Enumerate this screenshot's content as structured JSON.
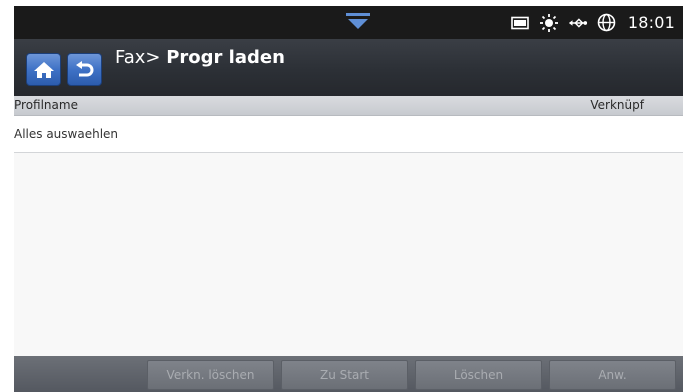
{
  "status_bar": {
    "clock": "18:01",
    "icons": [
      "notification-handle-icon",
      "toner-icon",
      "brightness-icon",
      "network-usb-icon",
      "globe-icon"
    ]
  },
  "title_bar": {
    "crumb": "Fax>",
    "title": "Progr laden",
    "home_icon": "home-icon",
    "back_icon": "back-arrow-icon",
    "accent_color": "#3f72c6"
  },
  "list_header": {
    "columns": [
      "Profilname",
      "Verknüpf"
    ]
  },
  "list": {
    "items": [
      "Alles auswaehlen"
    ]
  },
  "bottom_bar": {
    "buttons": [
      "Verkn. löschen",
      "Zu Start",
      "Löschen",
      "Anw."
    ]
  }
}
